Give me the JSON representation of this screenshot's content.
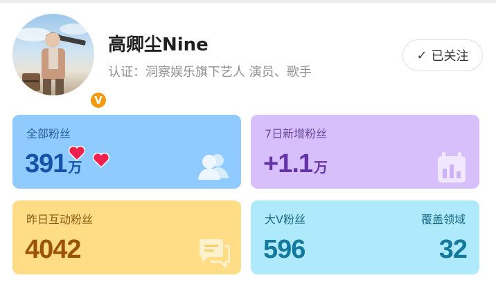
{
  "profile": {
    "name": "高卿尘Nine",
    "certification": "认证：洞察娱乐旗下艺人 演员、歌手",
    "verified_badge": "V",
    "follow_button_label": "已关注",
    "follow_icon": "checkmark-icon"
  },
  "cards": {
    "total_fans": {
      "label": "全部粉丝",
      "value": "391",
      "unit": "万",
      "icon": "people-icon"
    },
    "new_fans_7d": {
      "label": "7日新增粉丝",
      "value": "+1.1",
      "unit": "万",
      "icon": "bar-chart-icon"
    },
    "interactive_fans_yesterday": {
      "label": "昨日互动粉丝",
      "value": "4042",
      "icon": "chat-bubbles-icon"
    },
    "big_v_fans": {
      "label": "大V粉丝",
      "value": "596",
      "coverage_label": "覆盖领域",
      "coverage_value": "32"
    }
  },
  "colors": {
    "blue_card": "#8fcbff",
    "purple_card": "#d7bffb",
    "yellow_card": "#ffdc86",
    "cyan_card": "#aeeafb",
    "badge_orange": "#f39a12"
  }
}
